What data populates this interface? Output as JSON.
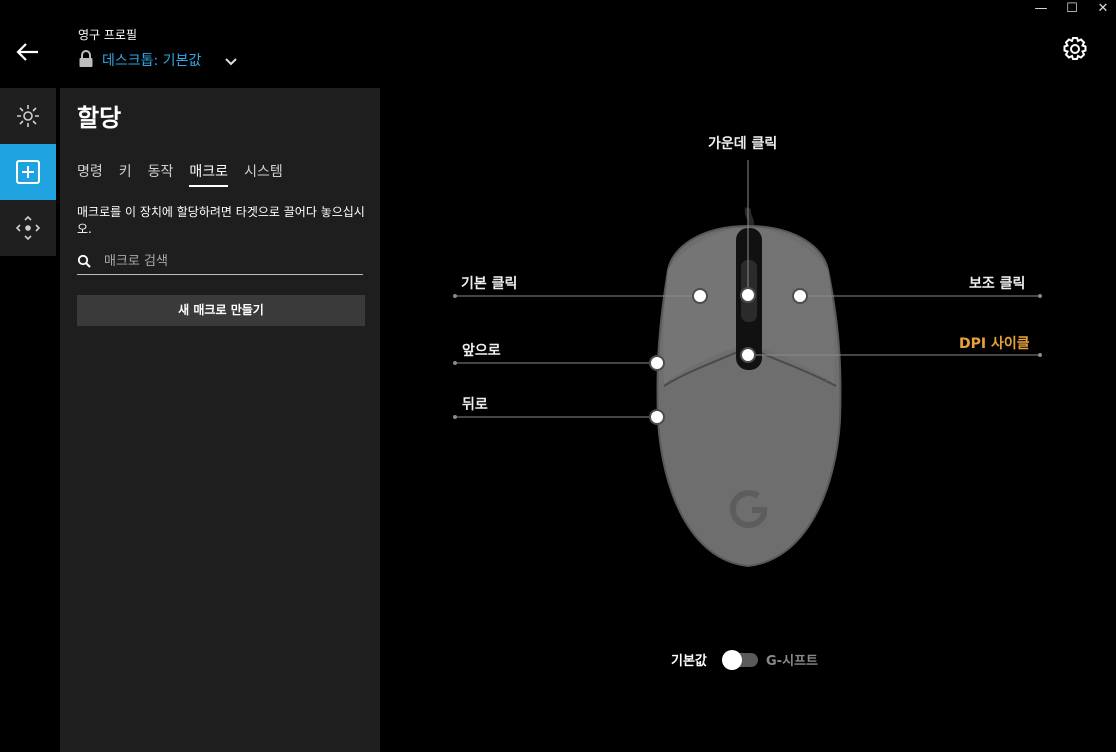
{
  "window_controls": {
    "minimize": "—",
    "maximize": "☐",
    "close": "✕"
  },
  "header": {
    "profile_label": "영구 프로필",
    "profile_name": "데스크톱: 기본값"
  },
  "panel": {
    "title": "할당",
    "tabs": [
      {
        "label": "명령",
        "active": false
      },
      {
        "label": "키",
        "active": false
      },
      {
        "label": "동작",
        "active": false
      },
      {
        "label": "매크로",
        "active": true
      },
      {
        "label": "시스템",
        "active": false
      }
    ],
    "hint": "매크로를 이 장치에 할당하려면 타겟으로 끌어다 놓으십시오.",
    "search_placeholder": "매크로 검색",
    "new_macro_button": "새 매크로 만들기"
  },
  "mouse_buttons": {
    "middle_click": "가운데 클릭",
    "primary_click": "기본 클릭",
    "secondary_click": "보조 클릭",
    "forward": "앞으로",
    "dpi_cycle": "DPI 사이클",
    "back": "뒤로"
  },
  "mode_toggle": {
    "left_label": "기본값",
    "right_label": "G-시프트",
    "state": "기본값"
  },
  "colors": {
    "accent": "#1fa3e0",
    "dpi": "#e8a23a",
    "panel": "#1e1e1e",
    "rail": "#1f1f1f"
  }
}
